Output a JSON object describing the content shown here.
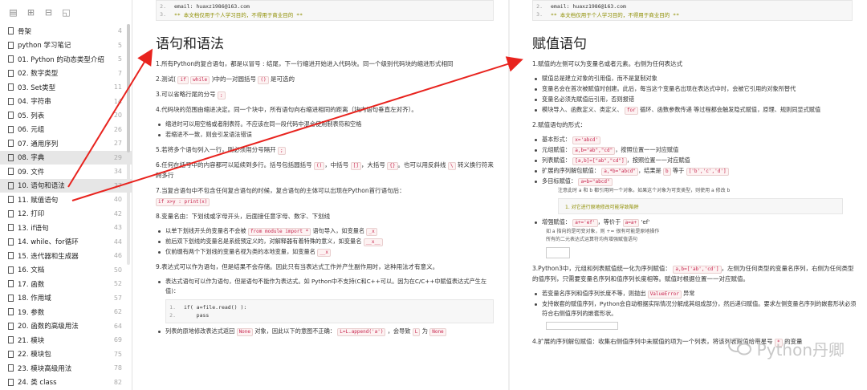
{
  "sidebar": {
    "items": [
      {
        "label": "骨架",
        "num": "4"
      },
      {
        "label": "python 学习笔记",
        "num": "5"
      },
      {
        "label": "01. Python 的动态类型介绍",
        "num": "5"
      },
      {
        "label": "02. 数字类型",
        "num": "7"
      },
      {
        "label": "03. Set类型",
        "num": "11"
      },
      {
        "label": "04. 字符串",
        "num": "14"
      },
      {
        "label": "05. 列表",
        "num": "20"
      },
      {
        "label": "06. 元组",
        "num": "26"
      },
      {
        "label": "07. 通用序列",
        "num": "27"
      },
      {
        "label": "08. 字典",
        "num": "29"
      },
      {
        "label": "09. 文件",
        "num": "34"
      },
      {
        "label": "10. 语句和语法",
        "num": "37"
      },
      {
        "label": "11. 赋值语句",
        "num": "40"
      },
      {
        "label": "12. 打印",
        "num": "42"
      },
      {
        "label": "13. if语句",
        "num": "43"
      },
      {
        "label": "14. while、for循环",
        "num": "44"
      },
      {
        "label": "15. 迭代器和生成器",
        "num": "46"
      },
      {
        "label": "16. 文档",
        "num": "50"
      },
      {
        "label": "17. 函数",
        "num": "52"
      },
      {
        "label": "18. 作用域",
        "num": "57"
      },
      {
        "label": "19. 参数",
        "num": "62"
      },
      {
        "label": "20. 函数的高级用法",
        "num": "64"
      },
      {
        "label": "21. 模块",
        "num": "69"
      },
      {
        "label": "22. 模块包",
        "num": "75"
      },
      {
        "label": "23. 模块高级用法",
        "num": "78"
      },
      {
        "label": "24. 类 class",
        "num": "82"
      }
    ]
  },
  "page1": {
    "code_top": [
      "email: huaxz1986@163.com",
      "** 本文档仅用于个人学习目的，不得用于商业目的 **"
    ],
    "code_top_nums": [
      "2.",
      "3."
    ],
    "title": "语句和语法",
    "p1": "1.所有Python的复合语句，都是以冒号 : 结尾，下一行缩进开始进入代码块。同一个级别代码块的缩进形式相同",
    "p2a": "2.测试(",
    "p2c1": "if",
    "p2c2": "while",
    "p2b": ")中的一对圆括号",
    "p2c3": "()",
    "p2d": "是可选的",
    "p3": "3.可以省略行尾的分号",
    "p3c": ";",
    "p4": "4.代码块的范围由缩进决定。同一个块中，所有语句向右缩进相同的距离（块内语句垂直左对齐）。",
    "b4": [
      "缩进时可以用空格或者制表符。不应该在同一段代码中混合使用制表符和空格",
      "若缩进不一致，则会引发语法错误"
    ],
    "p5": "5.若将多个语句列入一行，则必须用分号隔开",
    "p5c": ";",
    "p6a": "6.任何在括号中的内容都可以延续到多行。括号包括圆括号",
    "p6c1": "()",
    "p6b": "，中括号",
    "p6c2": "[]",
    "p6d": "，大括号",
    "p6c3": "{}",
    "p6e": "。也可以用反斜线",
    "p6c4": "\\",
    "p6f": "转义换行符来跨多行",
    "p7": "7.当复合语句中不包含任何复合语句的时候，复合语句的主体可以出现在Python首行语句后：",
    "p7c": "if x>y : print(x)",
    "p8": "8.变量名由：下划线或字母开头，后面接任意字母、数字、下划线",
    "b8a": "以单下划线开头的变量名不会被",
    "b8ac": "from module import *",
    "b8ab": "语句导入，如变量名",
    "b8acc": "_x",
    "b8b": "前后双下划线的变量名是系统预定义的，对解释器有着特殊的意义，如变量名",
    "b8bc": "__x__",
    "b8c": "仅前缀有两个下划线的变量名视为类的本地变量，如变量名",
    "b8cc": "__x",
    "p9": "9.表达式可以作为语句，但是结果不会存储。因此只有当表达式工作并产生副作用时，这种用法才有意义。",
    "b9": "表达式语句可以作为语句，但是语句不能作为表达式。如 Python中不支持(C和C++可以。因为在C/C++中赋值表达式产生左值)：",
    "code9": [
      "if( a=file.read() ):",
      "    pass"
    ],
    "code9_nums": [
      "1.",
      "2."
    ],
    "b9b": "列表的原地修改表达式返回",
    "b9bc": "None",
    "b9bb": "对象，因此以下的意图不正确：",
    "b9bc2": "L=L.append('a')",
    "b9bd": "，会导致",
    "b9bc3": "L",
    "b9be": "为",
    "b9bc4": "None"
  },
  "page2": {
    "code_top": [
      "email: huaxz1986@163.com",
      "** 本文档仅用于个人学习目的，不得用于商业目的 **"
    ],
    "code_top_nums": [
      "2.",
      "3."
    ],
    "title": "赋值语句",
    "p1": "1.赋值的左侧可以为变量名或者元素。右侧为任何表达式",
    "b1": [
      "赋值总是建立对象的引用值，而不是复制对象",
      "变量名会在首次被赋值时创建。此后，每当这个变量名出现在表达式中时，会被它引用的对象所替代",
      "变量名必须先赋值后引用，否则报错"
    ],
    "b1d1": "模块导入、函数定义、类定义、",
    "b1dc": "for",
    "b1d2": "循环、函数参数传递 等过程都会触发隐式赋值，原理、规则同显式赋值",
    "p2": "2.赋值语句的形式：",
    "f1": "基本形式：",
    "f1c": "x='abcd'",
    "f2": "元组赋值：",
    "f2c": "a,b=\"ab\",\"cd\"",
    "f2b": "，按照位置一一对应赋值",
    "f3": "列表赋值：",
    "f3c": "[a,b]=[\"ab\",\"cd\"]",
    "f3b": "，按照位置一一对应赋值",
    "f4": "扩展的序列解包赋值：",
    "f4c": "a,*b=\"abcd\"",
    "f4b": "，结果是",
    "f4c2": "b",
    "f4d": "等于",
    "f4c3": "['b','c','d']",
    "f5": "多目标赋值：",
    "f5c": "a=b=\"abcd\"",
    "f5s": "注意此时 a 和 b 都引用同一个对象。如果这个对象为可变类型，则使用 a 修改 b",
    "f5sub": "1. 对它进行原地修改可能导致陷阱",
    "f6": "增强赋值：",
    "f6c": "a+='ef'",
    "f6b": "，等价于",
    "f6c2": "a=a+",
    "f6d": "'ef'",
    "f6s": "如 a 指向的是可变对象，则 += 很有可能是原地操作",
    "f6s2": "所有的二元表达式运算符均有增强赋值语句",
    "p3a": "3.Python3中，元组和列表赋值统一化为序列赋值：",
    "p3c": "a,b=['ab','cd']",
    "p3b": "，左侧为任何类型的变量名序列，右侧为任何类型的值序列，只需要变量名序列和值序列长度相等。赋值时根据位置一一对应赋值。",
    "b3a": "若变量名序列和值序列长度不等，则抛出",
    "b3ac": "ValueError",
    "b3ab": "异常",
    "b3b": "支持嵌套的赋值序列，Python会自动根据实际情况分解成其组成部分，然后递归赋值。要求左侧变量名序列的嵌套形状必须符合右侧值序列的嵌套形状。",
    "p4a": "4.扩展的序列解包赋值：收集右侧值序列中未赋值的项为一个列表，将该列表赋值给带星号",
    "p4c": "*",
    "p4b": "的变量"
  },
  "watermark": "Python丹卿",
  "colors": {
    "arrow": "#e8231e",
    "code_bg": "#fdf2f2",
    "code_fg": "#c7254e"
  }
}
